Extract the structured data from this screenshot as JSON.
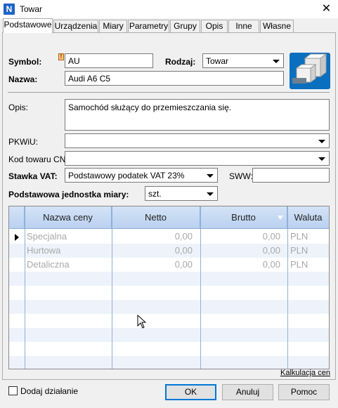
{
  "window": {
    "title": "Towar",
    "app_icon_letter": "N",
    "close_glyph": "✕"
  },
  "tabs": [
    {
      "label": "Podstawowe"
    },
    {
      "label": "Urządzenia"
    },
    {
      "label": "Miary"
    },
    {
      "label": "Parametry"
    },
    {
      "label": "Grupy"
    },
    {
      "label": "Opis"
    },
    {
      "label": "Inne"
    },
    {
      "label": "Własne"
    }
  ],
  "form": {
    "symbol_label": "Symbol:",
    "symbol_value": "AU",
    "rodzaj_label": "Rodzaj:",
    "rodzaj_value": "Towar",
    "nazwa_label": "Nazwa:",
    "nazwa_value": "Audi A6 C5",
    "opis_label": "Opis:",
    "opis_value": "Samochód służący do przemieszczania się.",
    "pkwiu_label": "PKWiU:",
    "pkwiu_value": "",
    "cn_label": "Kod towaru CN:",
    "cn_value": "",
    "vat_label": "Stawka VAT:",
    "vat_value": "Podstawowy podatek VAT 23%",
    "sww_label": "SWW:",
    "sww_value": "",
    "unit_label": "Podstawowa jednostka miary:",
    "unit_value": "szt."
  },
  "price_grid": {
    "columns": [
      "Nazwa ceny",
      "Netto",
      "Brutto",
      "Waluta"
    ],
    "rows": [
      {
        "name": "Specjalna",
        "netto": "0,00",
        "brutto": "0,00",
        "currency": "PLN"
      },
      {
        "name": "Hurtowa",
        "netto": "0,00",
        "brutto": "0,00",
        "currency": "PLN"
      },
      {
        "name": "Detaliczna",
        "netto": "0,00",
        "brutto": "0,00",
        "currency": "PLN"
      }
    ]
  },
  "kalkulacja_link": "Kalkulacja cen",
  "footer": {
    "add_action_label": "Dodaj działanie",
    "ok_label": "OK",
    "cancel_label": "Anuluj",
    "help_label": "Pomoc"
  },
  "colors": {
    "accent": "#0078d7",
    "grid_header": "#c7dbf4",
    "icon_blue": "#1f63c6"
  }
}
